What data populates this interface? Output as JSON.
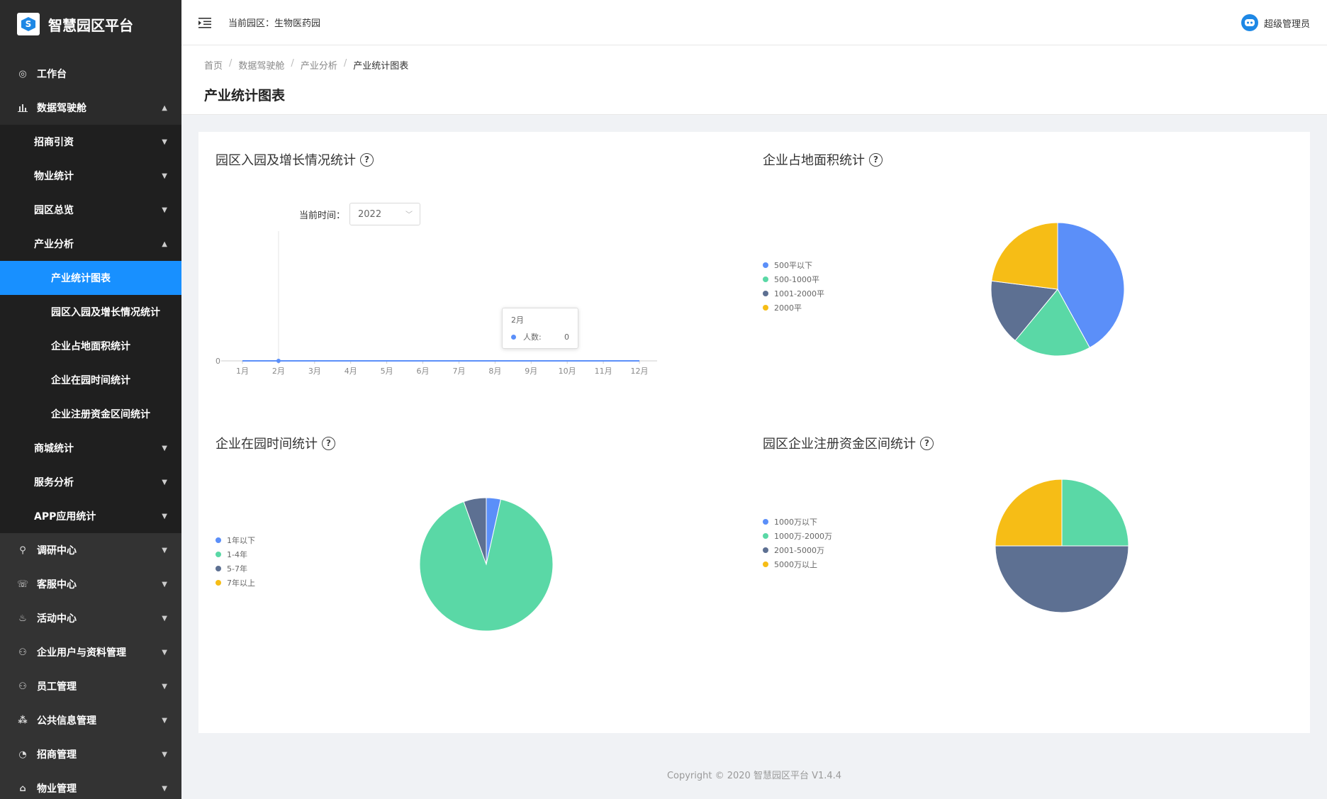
{
  "app": {
    "title": "智慧园区平台"
  },
  "sidebar": {
    "items": [
      {
        "icon": "dashboard-icon",
        "label": "工作台"
      },
      {
        "icon": "bar-chart-icon",
        "label": "数据驾驶舱"
      }
    ],
    "cockpit_children": [
      {
        "label": "招商引资"
      },
      {
        "label": "物业统计"
      },
      {
        "label": "园区总览"
      },
      {
        "label": "产业分析"
      }
    ],
    "industry_children": [
      {
        "label": "产业统计图表"
      },
      {
        "label": "园区入园及增长情况统计"
      },
      {
        "label": "企业占地面积统计"
      },
      {
        "label": "企业在园时间统计"
      },
      {
        "label": "企业注册资金区间统计"
      }
    ],
    "cockpit_rest": [
      {
        "label": "商城统计"
      },
      {
        "label": "服务分析"
      },
      {
        "label": "APP应用统计"
      }
    ],
    "bottom_items": [
      {
        "icon": "search-icon",
        "label": "调研中心"
      },
      {
        "icon": "headset-icon",
        "label": "客服中心"
      },
      {
        "icon": "fire-icon",
        "label": "活动中心"
      },
      {
        "icon": "users-icon",
        "label": "企业用户与资料管理"
      },
      {
        "icon": "users-icon",
        "label": "员工管理"
      },
      {
        "icon": "network-icon",
        "label": "公共信息管理"
      },
      {
        "icon": "pie-icon",
        "label": "招商管理"
      },
      {
        "icon": "home-icon",
        "label": "物业管理"
      }
    ]
  },
  "header": {
    "park_label": "当前园区：生物医药园",
    "user_name": "超级管理员"
  },
  "breadcrumb": [
    "首页",
    "数据驾驶舱",
    "产业分析",
    "产业统计图表"
  ],
  "page_title": "产业统计图表",
  "panels": {
    "line_title": "园区入园及增长情况统计",
    "area_title": "企业占地面积统计",
    "time_title": "企业在园时间统计",
    "capital_title": "园区企业注册资金区间统计",
    "filter_label": "当前时间：",
    "filter_value": "2022",
    "tooltip_month": "2月",
    "tooltip_series": "人数:",
    "tooltip_value": "0"
  },
  "colors": {
    "blue": "#5b8ff9",
    "green": "#5ad8a6",
    "slate": "#5d7092",
    "yellow": "#f6bd16",
    "accent": "#1890ff"
  },
  "chart_data": [
    {
      "type": "line",
      "categories": [
        "1月",
        "2月",
        "3月",
        "4月",
        "5月",
        "6月",
        "7月",
        "8月",
        "9月",
        "10月",
        "11月",
        "12月"
      ],
      "series": [
        {
          "name": "人数",
          "values": [
            0,
            0,
            0,
            0,
            0,
            0,
            0,
            0,
            0,
            0,
            0,
            0
          ]
        }
      ],
      "yticks": [
        "0"
      ]
    },
    {
      "type": "pie",
      "labels": [
        "500平以下",
        "500-1000平",
        "1001-2000平",
        "2000平"
      ],
      "values": [
        42,
        19,
        16,
        23
      ]
    },
    {
      "type": "pie",
      "labels": [
        "1年以下",
        "1-4年",
        "5-7年",
        "7年以上"
      ],
      "values": [
        3.5,
        91,
        5.5,
        0
      ]
    },
    {
      "type": "pie",
      "labels": [
        "1000万以下",
        "1000万-2000万",
        "2001-5000万",
        "5000万以上"
      ],
      "values": [
        0,
        25,
        50,
        25
      ]
    }
  ],
  "footer": {
    "text": "Copyright © 2020 智慧园区平台 V1.4.4"
  }
}
